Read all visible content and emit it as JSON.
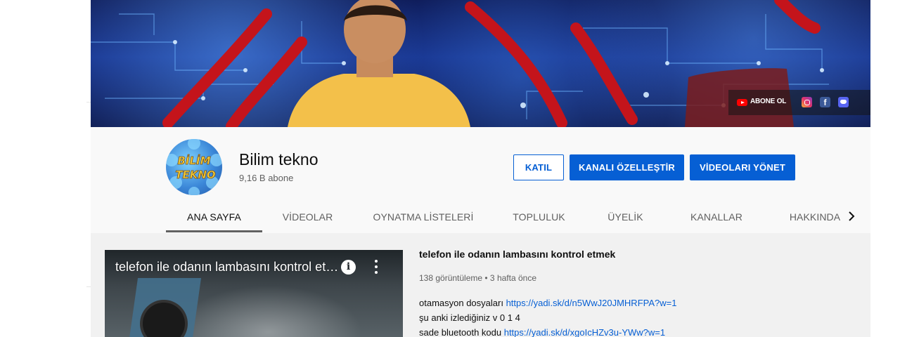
{
  "banner": {
    "subscribe_link": "ABONE OL",
    "social_icons": [
      "instagram-icon",
      "facebook-icon",
      "discord-icon"
    ],
    "facebook_glyph": "f"
  },
  "channel": {
    "avatar_text_line1": "BİLİM",
    "avatar_text_line2": "TEKNO",
    "name": "Bilim tekno",
    "subscribers": "9,16 B abone"
  },
  "actions": {
    "join": "KATIL",
    "customize": "KANALI ÖZELLEŞTİR",
    "manage_videos": "VİDEOLARI YÖNET"
  },
  "tabs": [
    {
      "label": "ANA SAYFA",
      "active": true
    },
    {
      "label": "VİDEOLAR",
      "active": false
    },
    {
      "label": "OYNATMA LİSTELERİ",
      "active": false
    },
    {
      "label": "TOPLULUK",
      "active": false
    },
    {
      "label": "ÜYELİK",
      "active": false
    },
    {
      "label": "KANALLAR",
      "active": false
    },
    {
      "label": "HAKKINDA",
      "active": false
    }
  ],
  "featured_video": {
    "overlay_title": "telefon ile odanın lambasını kontrol et…",
    "title": "telefon ile odanın lambasını kontrol etmek",
    "meta": "138 görüntüleme • 3 hafta önce",
    "description": {
      "line1_text": "otamasyon dosyaları ",
      "line1_link": "https://yadi.sk/d/n5WwJ20JMHRFPA?w=1",
      "line2_text": "şu anki izlediğiniz v 0 1 4",
      "line3_text": "sade bluetooth kodu ",
      "line3_link": "https://yadi.sk/d/xgoIcHZv3u-YWw?w=1"
    }
  },
  "colors": {
    "accent": "#065fd4",
    "youtube_red": "#ff0000",
    "page_bg": "#f9f9f9",
    "content_bg": "#f1f1f1"
  }
}
